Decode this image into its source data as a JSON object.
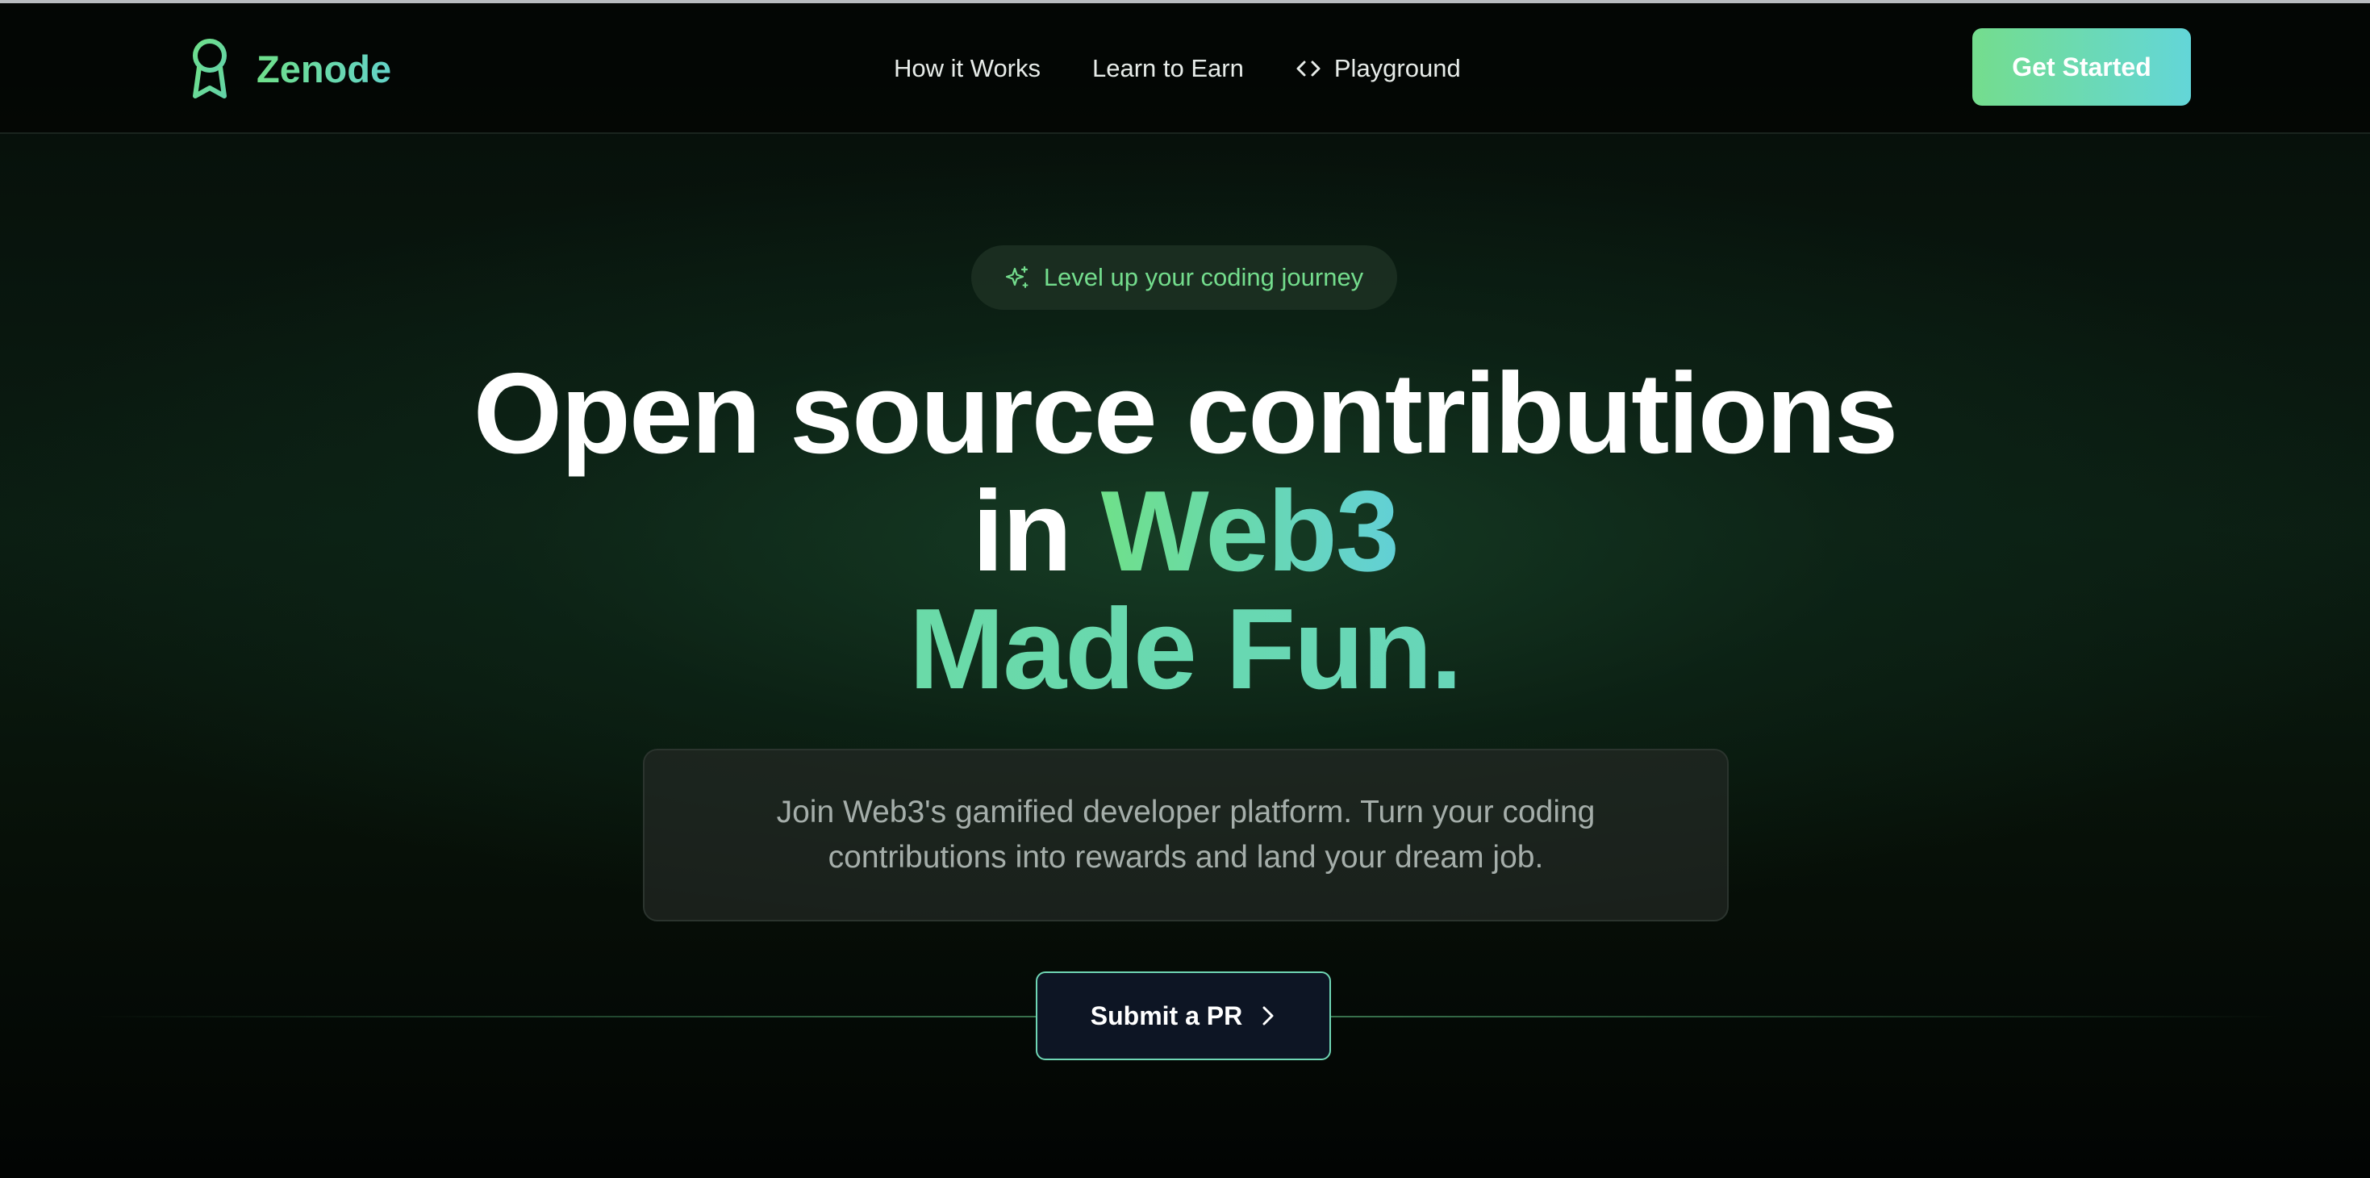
{
  "nav": {
    "brand": "Zenode",
    "links": [
      "How it Works",
      "Learn to Earn",
      "Playground"
    ],
    "cta": "Get Started"
  },
  "hero": {
    "badge": "Level up your coding journey",
    "headline_line1": "Open source contributions",
    "headline_line2_prefix": "in ",
    "headline_line2_highlight": "Web3",
    "headline_line3": "Made Fun.",
    "description": "Join Web3's gamified developer platform. Turn your coding contributions into rewards and land your dream job.",
    "submit_label": "Submit a PR"
  },
  "icons": {
    "brand": "award-icon",
    "playground": "code-icon",
    "badge": "sparkles-icon",
    "submit": "chevron-right-icon"
  },
  "colors": {
    "accent_green": "#74dd8d",
    "accent_cyan": "#63d6d8",
    "background": "#020403",
    "submit_bg": "#0d1524"
  }
}
